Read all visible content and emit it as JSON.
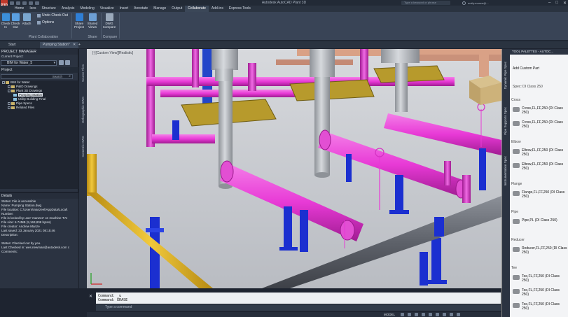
{
  "window": {
    "title": "Autodesk AutoCAD Plant 3D",
    "app_badge": "P3D",
    "search_placeholder": "Type a keyword or phrase",
    "user": "emily.manze@..."
  },
  "ribbon": {
    "tabs": [
      "Home",
      "Isos",
      "Structure",
      "Analysis",
      "Modeling",
      "Visualize",
      "Insert",
      "Annotate",
      "Manage",
      "Output",
      "Collaborate",
      "Add-ins",
      "Express Tools"
    ],
    "active_tab": "Collaborate",
    "buttons": {
      "check_in": "Check In",
      "check_out": "Check Out",
      "attach": "Attach",
      "undo_check_out": "Undo Check Out",
      "options": "Options",
      "share_project": "Share Project",
      "shared_views": "Shared Views",
      "dwg_compare": "DWG Compare"
    },
    "panels": {
      "plant_collab": "Plant Collaboration",
      "share": "Share",
      "compare": "Compare"
    }
  },
  "doc_tabs": {
    "start": "Start",
    "active": "Pumping Station*"
  },
  "project_manager": {
    "title": "PROJECT MANAGER",
    "current_project_label": "Current Project:",
    "current_project": "BIM for Water_5",
    "project_header": "Project",
    "search_label": "Search",
    "tree": [
      {
        "label": "BIM for Water",
        "level": 0,
        "type": "root"
      },
      {
        "label": "P&ID Drawings",
        "level": 1,
        "type": "folder"
      },
      {
        "label": "Plant 3D Drawings",
        "level": 1,
        "type": "folder"
      },
      {
        "label": "Pumping Station",
        "level": 2,
        "type": "dwg",
        "selected": true
      },
      {
        "label": "Utility Building Final",
        "level": 2,
        "type": "dwg"
      },
      {
        "label": "Pipe Specs",
        "level": 1,
        "type": "folder"
      },
      {
        "label": "Related Files",
        "level": 1,
        "type": "folder"
      }
    ],
    "side_tabs": [
      "Source Files",
      "Orthographic DWG",
      "Isometric DWG"
    ]
  },
  "details": {
    "title": "Details",
    "lines": [
      "Status: File is accessible",
      "Name: Pumping Station.dwg",
      "File location: C:\\Users\\manzeel\\AppData\\Local\\",
      "Number:",
      "File is locked by user 'manzee' on machine 'FAI",
      "File size: 6.74MB (9,163,808 bytes)",
      "File creator: Andrew Manze",
      "Last saved: 23 January 2021 08:15:46",
      "Description:",
      "",
      "Status: Checked out by you.",
      "Last Checked in: wes.newman@autodesk.com c",
      "Comments:"
    ]
  },
  "viewport": {
    "label": "[-][Custom View][Realistic]"
  },
  "command": {
    "history": [
      "Command: _u",
      "Command: ERASE"
    ],
    "placeholder": "Type a command"
  },
  "status_bar": {
    "model": "MODEL"
  },
  "tool_palettes": {
    "title": "TOOL PALETTES - AUTOC...",
    "add_custom_part": "Add Custom Part",
    "spec": "Spec: DI Class 250",
    "side_tabs": [
      "Dynamic Pipe Spec",
      "Pipe Supports Spec",
      "Instrumentation Spec"
    ],
    "sections": [
      {
        "name": "Cross",
        "items": [
          "Cross,FL,FF,250 (DI Class 250)",
          "Cross,FL,FF,250 (DI Class 250)"
        ]
      },
      {
        "name": "Elbow",
        "items": [
          "Elbow,FL,FF,250 (DI Class 250)",
          "Elbow,FL,FF,250 (DI Class 250)"
        ]
      },
      {
        "name": "Flange",
        "items": [
          "Flange,FL,FF,250 (DI Class 250)"
        ]
      },
      {
        "name": "Pipe",
        "items": [
          "Pipe,PL (DI Class 250)"
        ]
      },
      {
        "name": "Reducer",
        "items": [
          "Reducer,FL,FF,250 (DI Class 250)"
        ]
      },
      {
        "name": "Tee",
        "items": [
          "Tee,FL,FF,250 (DI Class 250)",
          "Tee,FL,FF,250 (DI Class 250)",
          "Tee,FL,FF,250 (DI Class 250)"
        ]
      }
    ]
  },
  "colors": {
    "pipe_magenta": "#e83ad6",
    "pipe_yellow": "#e0b321",
    "pipe_gray": "#6b6f77",
    "support_blue": "#1b2fd0",
    "platform_olive": "#b79a2c",
    "tank_gray": "#a9adb3",
    "pipe_salmon": "#d9a186"
  }
}
